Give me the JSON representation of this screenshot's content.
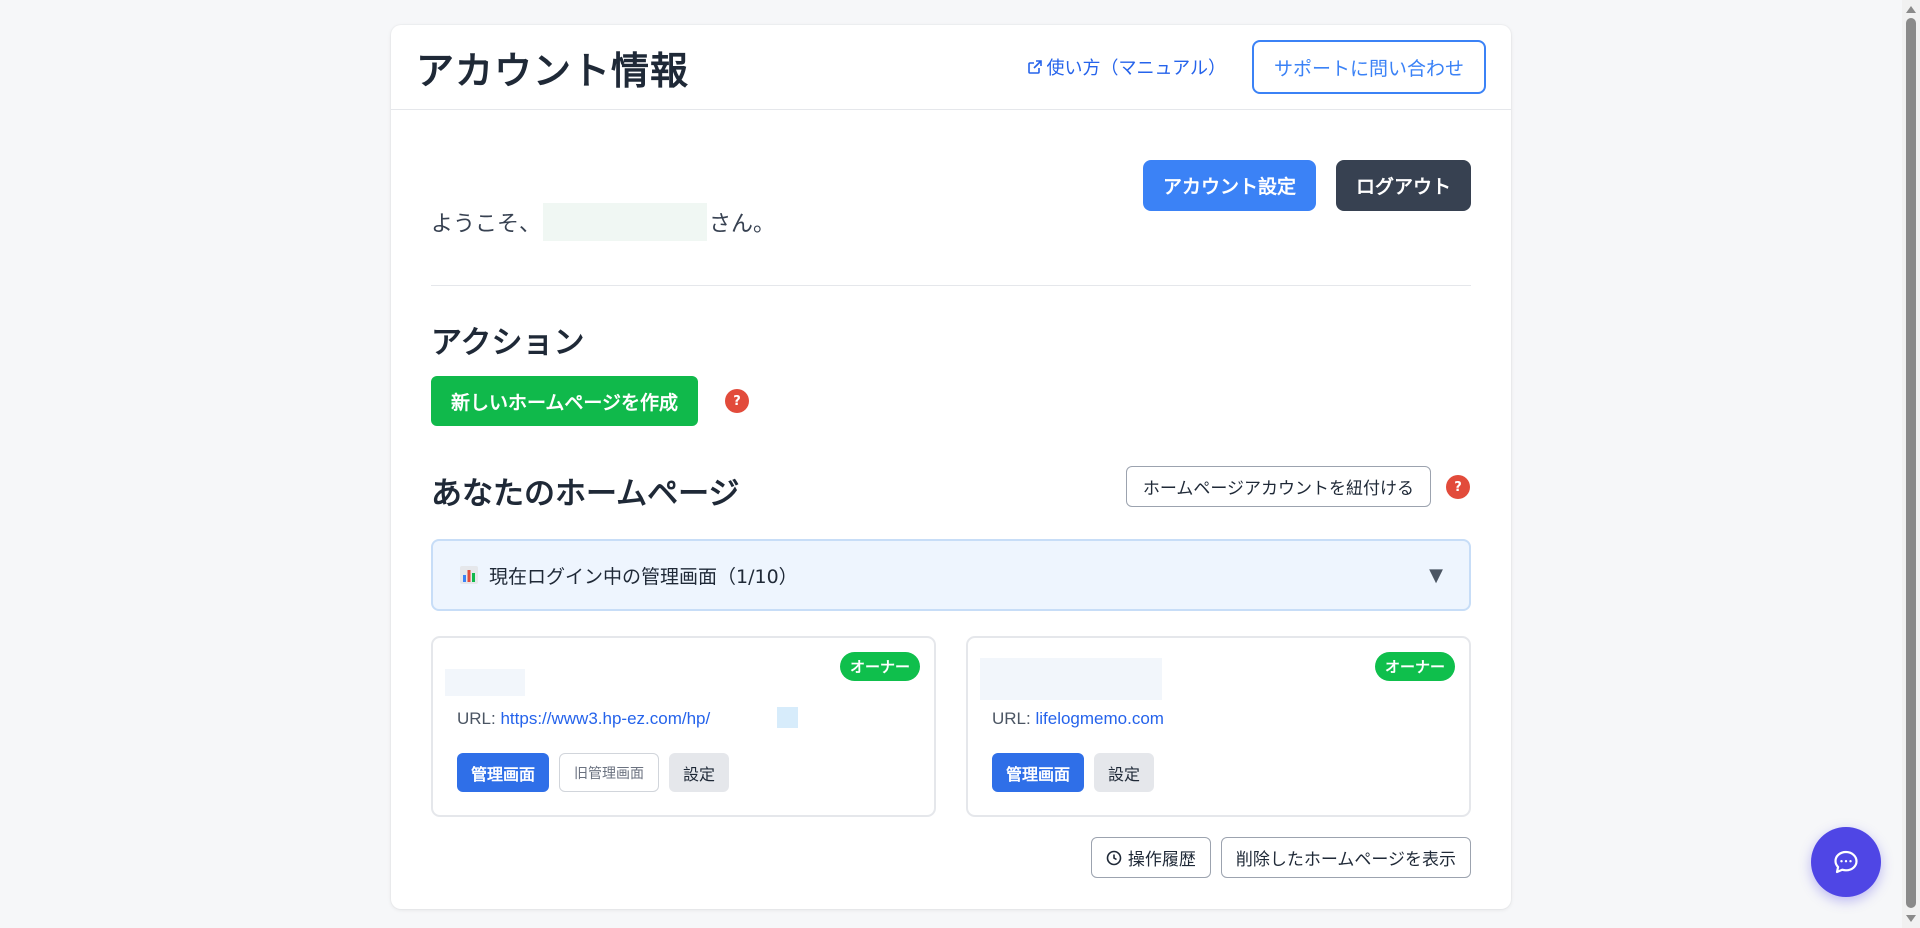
{
  "header": {
    "title": "アカウント情報",
    "manual_link": "使い方（マニュアル）",
    "support_button": "サポートに問い合わせ"
  },
  "account_buttons": {
    "settings": "アカウント設定",
    "logout": "ログアウト"
  },
  "welcome": {
    "prefix": "ようこそ、",
    "suffix": "さん。"
  },
  "actions": {
    "title": "アクション",
    "create_button": "新しいホームページを作成",
    "help": "?"
  },
  "homepages": {
    "title": "あなたのホームページ",
    "link_account_button": "ホームページアカウントを紐付ける",
    "help": "?",
    "accordion_label": "現在ログイン中の管理画面（1/10）",
    "accordion_arrow": "▼",
    "sites": [
      {
        "badge": "オーナー",
        "url_label": "URL:",
        "url": "https://www3.hp-ez.com/hp/",
        "buttons": {
          "admin": "管理画面",
          "old_admin": "旧管理画面",
          "settings": "設定"
        }
      },
      {
        "badge": "オーナー",
        "url_label": "URL:",
        "url": "lifelogmemo.com",
        "buttons": {
          "admin": "管理画面",
          "settings": "設定"
        }
      }
    ],
    "history_button": "操作履歴",
    "deleted_button": "削除したホームページを表示"
  },
  "icons": {
    "manual": "external-link-icon",
    "accordion": "bar-chart-icon",
    "history": "clock-icon",
    "chat": "chat-bubble-icon"
  },
  "colors": {
    "primary": "#3b82f6",
    "dark": "#374151",
    "success": "#10b94b",
    "help": "#e24b3b",
    "chat": "#4f46e5"
  }
}
